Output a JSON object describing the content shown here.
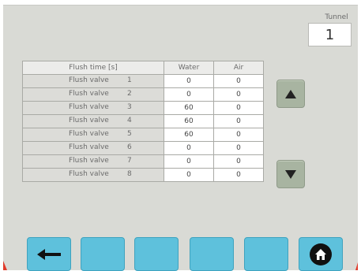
{
  "tunnel": {
    "label": "Tunnel",
    "value": "1"
  },
  "table": {
    "headers": {
      "name": "Flush time [s]",
      "water": "Water",
      "air": "Air"
    },
    "rows": [
      {
        "label": "Flush valve",
        "num": "1",
        "water": "0",
        "air": "0"
      },
      {
        "label": "Flush valve",
        "num": "2",
        "water": "0",
        "air": "0"
      },
      {
        "label": "Flush valve",
        "num": "3",
        "water": "60",
        "air": "0"
      },
      {
        "label": "Flush valve",
        "num": "4",
        "water": "60",
        "air": "0"
      },
      {
        "label": "Flush valve",
        "num": "5",
        "water": "60",
        "air": "0"
      },
      {
        "label": "Flush valve",
        "num": "6",
        "water": "0",
        "air": "0"
      },
      {
        "label": "Flush valve",
        "num": "7",
        "water": "0",
        "air": "0"
      },
      {
        "label": "Flush valve",
        "num": "8",
        "water": "0",
        "air": "0"
      }
    ]
  },
  "scroll": {
    "up_icon": "triangle-up-icon",
    "down_icon": "triangle-down-icon"
  },
  "function_keys": {
    "back_icon": "arrow-left-icon",
    "home_icon": "home-icon"
  },
  "colors": {
    "background": "#d9dad5",
    "function_key": "#5ec1dc",
    "scroll_button": "#a8b4a1",
    "accent_corner": "#e03a2a"
  }
}
